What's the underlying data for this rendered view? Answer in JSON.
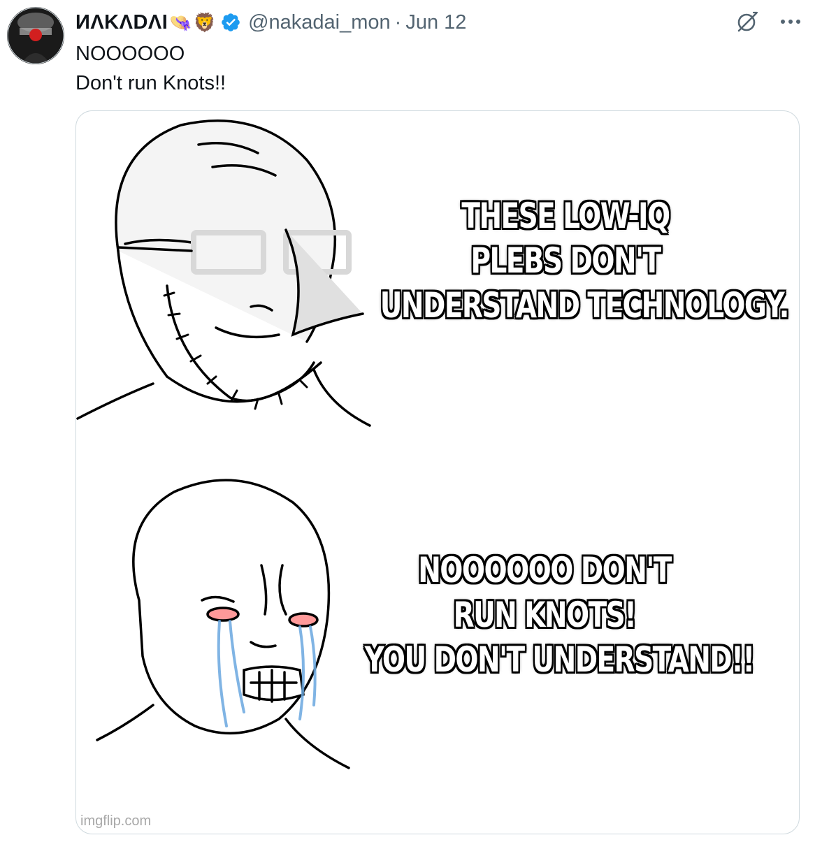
{
  "tweet": {
    "author": {
      "display_name": "ИΛKΛDΛI",
      "name_emojis": [
        "👒",
        "🦁"
      ],
      "verified": true,
      "handle": "@nakadai_mon",
      "separator": "·",
      "date": "Jun 12"
    },
    "text_lines": [
      "NOOOOOO",
      "Don't run Knots!!"
    ],
    "media": {
      "top_caption_lines": [
        "THESE LOW-IQ",
        "PLEBS DON'T",
        "UNDERSTAND TECHNOLOGY."
      ],
      "bottom_caption_lines": [
        "NOOOOOO DON'T",
        "RUN KNOTS!",
        "YOU DON'T UNDERSTAND!!"
      ],
      "watermark": "imgflip.com"
    }
  },
  "icons": {
    "verified": "verified-badge-icon",
    "grok": "grok-icon",
    "more": "more-options-icon"
  },
  "colors": {
    "text": "#0f1419",
    "secondary": "#536471",
    "verified": "#1d9bf0",
    "card_border": "#cfd9de",
    "tears": "#6aa8e0"
  }
}
